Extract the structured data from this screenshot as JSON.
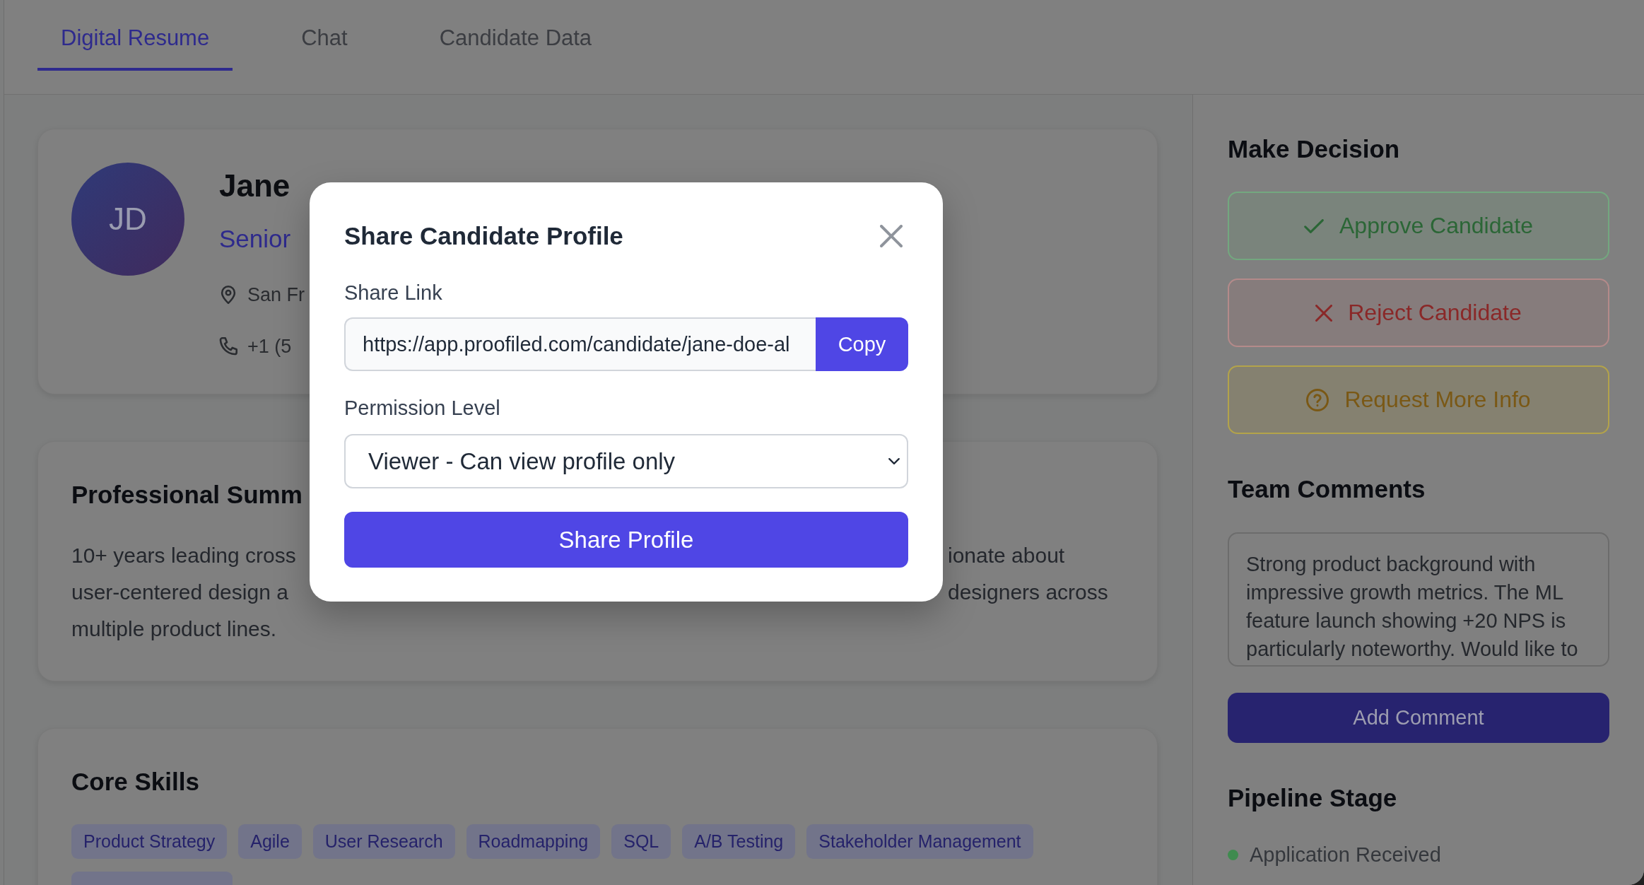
{
  "tabs": [
    {
      "label": "Digital Resume",
      "selected": true
    },
    {
      "label": "Chat",
      "selected": false
    },
    {
      "label": "Candidate Data",
      "selected": false
    }
  ],
  "profile": {
    "initials": "JD",
    "name": "Jane",
    "title": "Senior",
    "details": [
      {
        "kind": "location",
        "text": "San Fr"
      },
      {
        "kind": "phone",
        "text": "+1 (5"
      }
    ]
  },
  "summary": {
    "heading": "Professional Summ",
    "lines": [
      {
        "left": "10+ years leading cross",
        "right": "ionate about"
      },
      {
        "left": "user-centered design a",
        "right": "designers across"
      },
      {
        "left": "multiple product lines."
      }
    ]
  },
  "skills": {
    "heading": "Core Skills",
    "tags": [
      "Product Strategy",
      "Agile",
      "User Research",
      "Roadmapping",
      "SQL",
      "A/B Testing",
      "Stakeholder Management"
    ]
  },
  "decision": {
    "heading": "Make Decision",
    "actions": [
      {
        "kind": "approve",
        "label": "Approve Candidate"
      },
      {
        "kind": "reject",
        "label": "Reject Candidate"
      },
      {
        "kind": "request_info",
        "label": "Request More Info"
      }
    ]
  },
  "comments": {
    "heading": "Team Comments",
    "value": "Strong product background with impressive growth metrics. The ML feature launch showing +20 NPS is particularly noteworthy. Would like to",
    "button": "Add Comment"
  },
  "pipeline": {
    "heading": "Pipeline Stage",
    "stages": [
      {
        "label": "Application Received",
        "color": "#3f8b4f"
      }
    ]
  },
  "share_modal": {
    "title": "Share Candidate Profile",
    "link_label": "Share Link",
    "link_value": "https://app.proofiled.com/candidate/jane-doe-al",
    "copy_button": "Copy",
    "permission_label": "Permission Level",
    "permission_value": "Viewer - Can view profile only",
    "submit_button": "Share Profile"
  }
}
